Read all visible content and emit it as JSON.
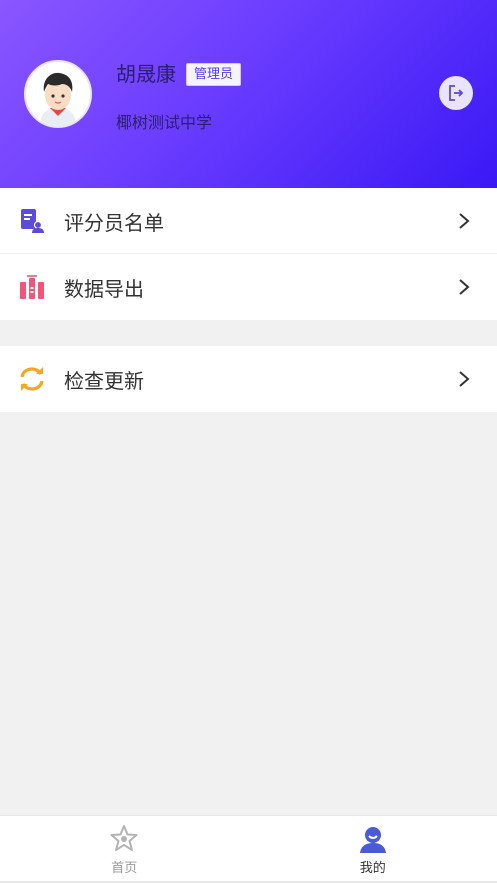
{
  "profile": {
    "name": "胡晟康",
    "role_badge": "管理员",
    "school": "椰树测试中学",
    "logout_icon": "logout-icon"
  },
  "menu": {
    "group1": [
      {
        "label": "评分员名单",
        "icon": "grader-list-icon",
        "icon_color": "#5b4bd8"
      },
      {
        "label": "数据导出",
        "icon": "data-export-icon",
        "icon_color": "#f0557a"
      }
    ],
    "group2": [
      {
        "label": "检查更新",
        "icon": "refresh-icon",
        "icon_color": "#f5a623"
      }
    ]
  },
  "tabbar": {
    "tabs": [
      {
        "label": "首页",
        "icon": "home-star-icon",
        "active": false
      },
      {
        "label": "我的",
        "icon": "profile-icon",
        "active": true
      }
    ]
  },
  "colors": {
    "header_gradient_start": "#8a56ff",
    "header_gradient_end": "#3a18f5",
    "accent": "#4a5bd8"
  }
}
